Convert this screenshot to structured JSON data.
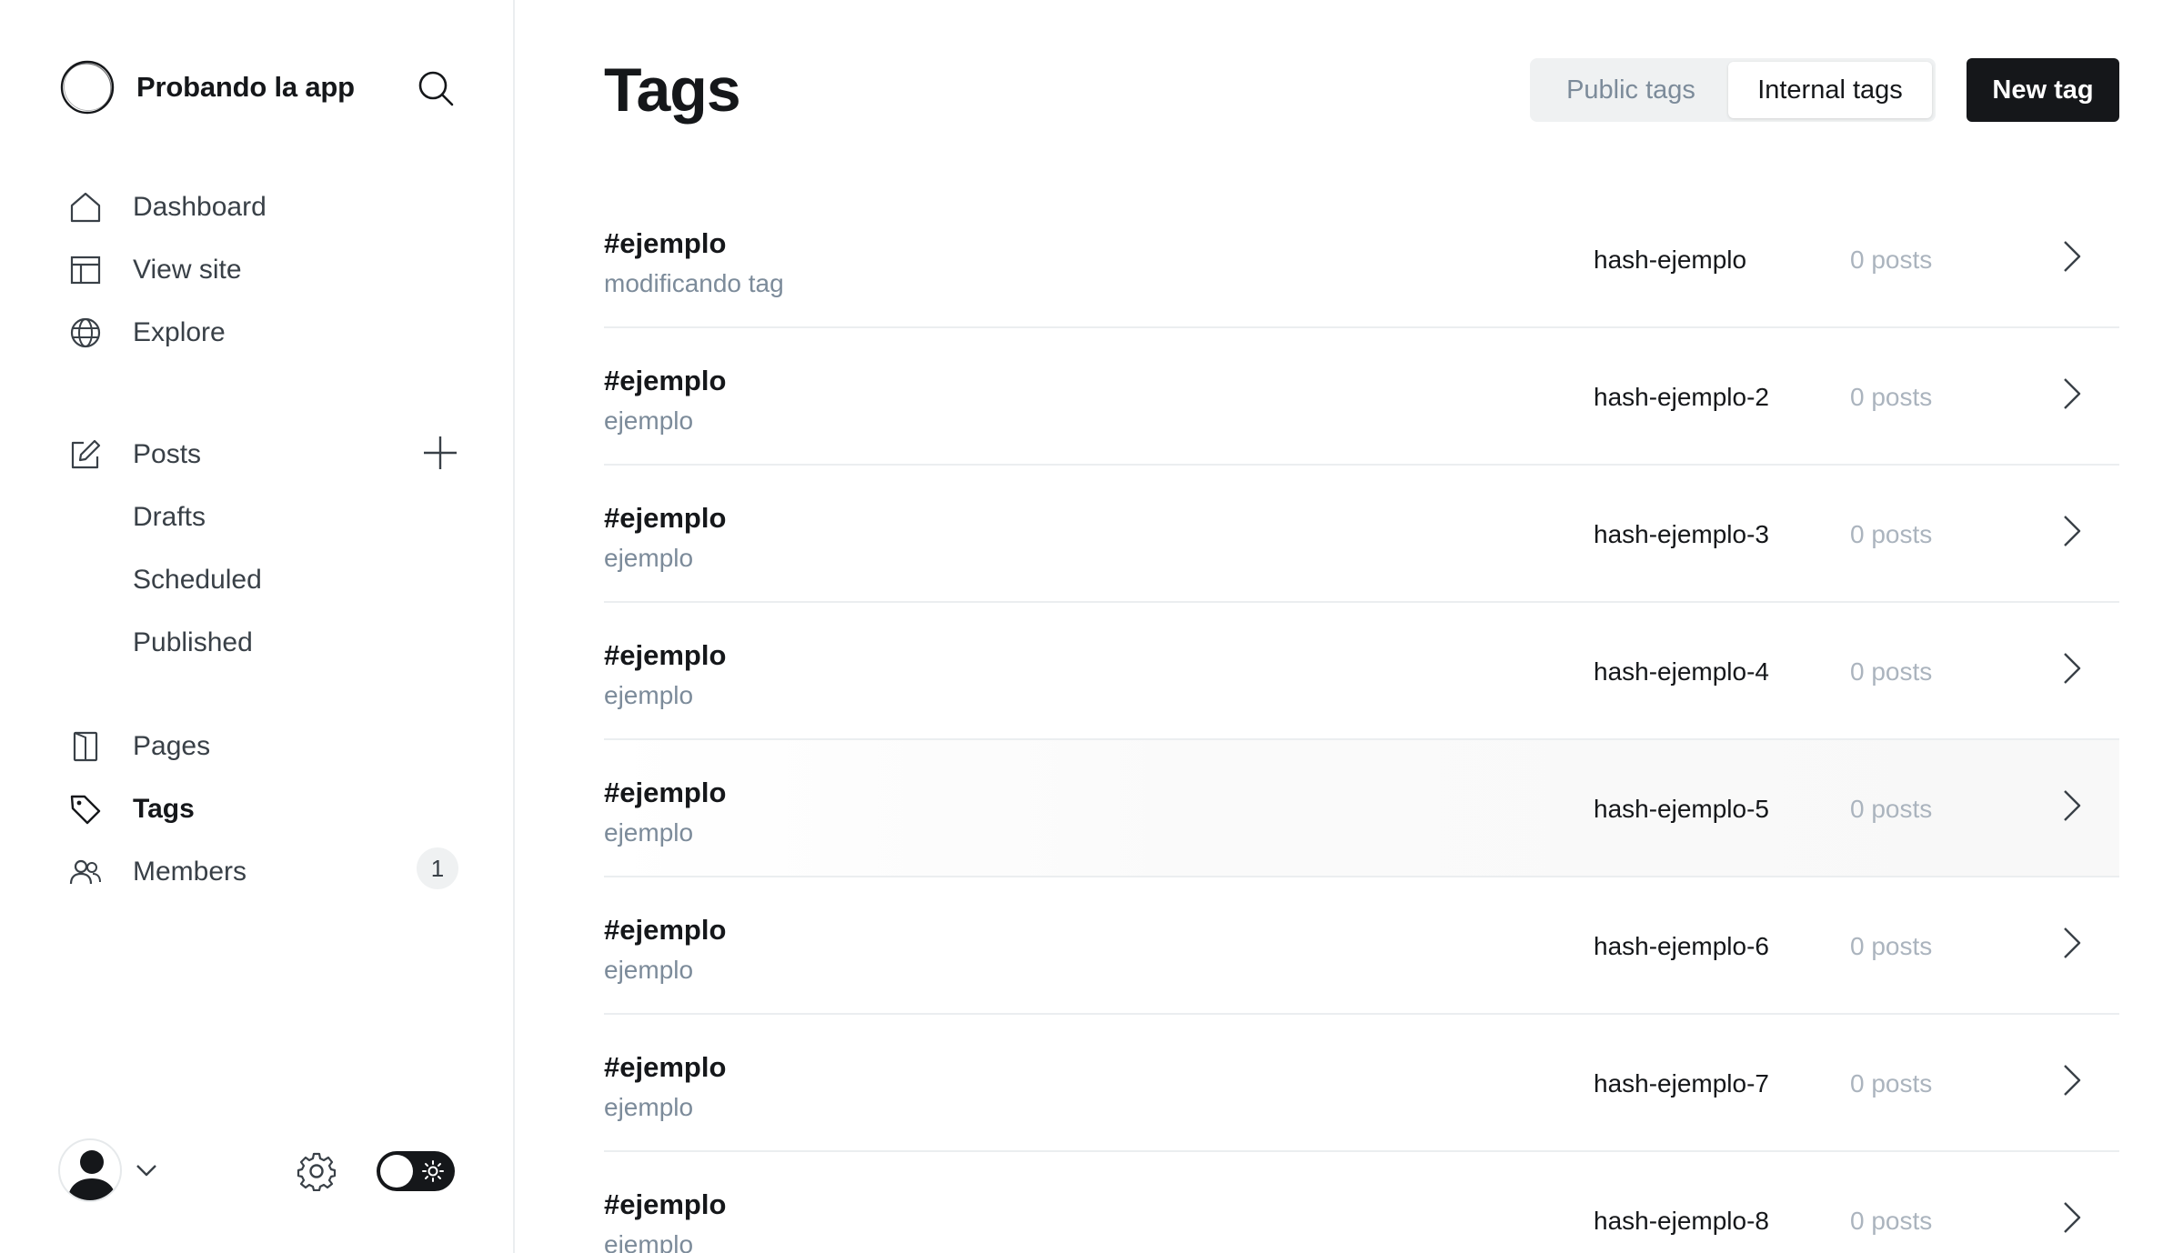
{
  "sidebar": {
    "brand_name": "Probando la app",
    "nav": {
      "dashboard": "Dashboard",
      "view_site": "View site",
      "explore": "Explore",
      "posts": "Posts",
      "drafts": "Drafts",
      "scheduled": "Scheduled",
      "published": "Published",
      "pages": "Pages",
      "tags": "Tags",
      "members": "Members"
    },
    "members_count": "1",
    "active_item": "Tags",
    "theme": "light"
  },
  "header": {
    "title": "Tags",
    "tabs": {
      "public": "Public tags",
      "internal": "Internal tags"
    },
    "selected_tab": "Internal tags",
    "new_tag_label": "New tag"
  },
  "tags": [
    {
      "name": "#ejemplo",
      "description": "modificando tag",
      "slug": "hash-ejemplo",
      "posts": "0 posts"
    },
    {
      "name": "#ejemplo",
      "description": "ejemplo",
      "slug": "hash-ejemplo-2",
      "posts": "0 posts"
    },
    {
      "name": "#ejemplo",
      "description": "ejemplo",
      "slug": "hash-ejemplo-3",
      "posts": "0 posts"
    },
    {
      "name": "#ejemplo",
      "description": "ejemplo",
      "slug": "hash-ejemplo-4",
      "posts": "0 posts"
    },
    {
      "name": "#ejemplo",
      "description": "ejemplo",
      "slug": "hash-ejemplo-5",
      "posts": "0 posts"
    },
    {
      "name": "#ejemplo",
      "description": "ejemplo",
      "slug": "hash-ejemplo-6",
      "posts": "0 posts"
    },
    {
      "name": "#ejemplo",
      "description": "ejemplo",
      "slug": "hash-ejemplo-7",
      "posts": "0 posts"
    },
    {
      "name": "#ejemplo",
      "description": "ejemplo",
      "slug": "hash-ejemplo-8",
      "posts": "0 posts"
    }
  ],
  "colors": {
    "text": "#15171a",
    "muted": "#7c8b9a",
    "faint": "#abb4be",
    "border": "#ebeef0",
    "button": "#15171a"
  }
}
